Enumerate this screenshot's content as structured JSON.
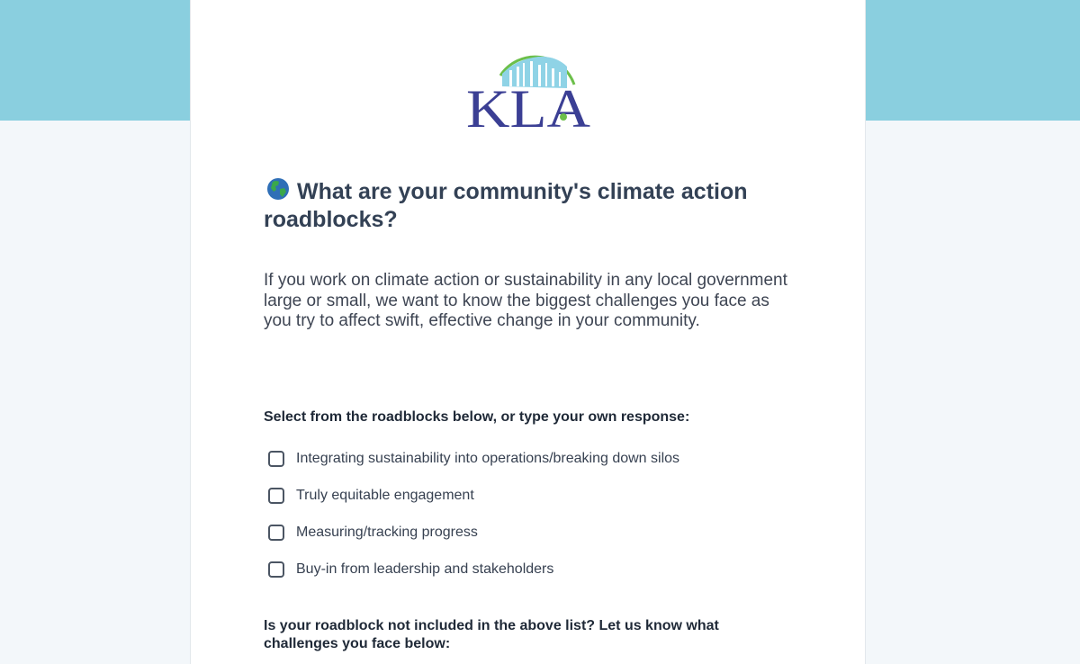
{
  "brand": {
    "logo_text": "KLA",
    "colors": {
      "band": "#8acfdf",
      "logo_navy": "#3b3f94",
      "logo_sky": "#8fd3e6",
      "logo_green": "#6cbf4a"
    }
  },
  "survey": {
    "title_icon": "globe-americas-icon",
    "title": "What are your community's climate action roadblocks?",
    "intro": "If you work on climate action or sustainability in any local government large or small, we want to know the biggest challenges you face as you try to affect swift, effective change in your community.",
    "select_prompt": "Select from the roadblocks below, or type your own response:",
    "options": [
      {
        "label": "Integrating sustainability into operations/breaking down silos",
        "checked": false
      },
      {
        "label": "Truly equitable engagement",
        "checked": false
      },
      {
        "label": "Measuring/tracking progress",
        "checked": false
      },
      {
        "label": "Buy-in from leadership and stakeholders",
        "checked": false
      }
    ],
    "other_prompt": "Is your roadblock not included in the above list? Let us know what challenges you face below:"
  }
}
